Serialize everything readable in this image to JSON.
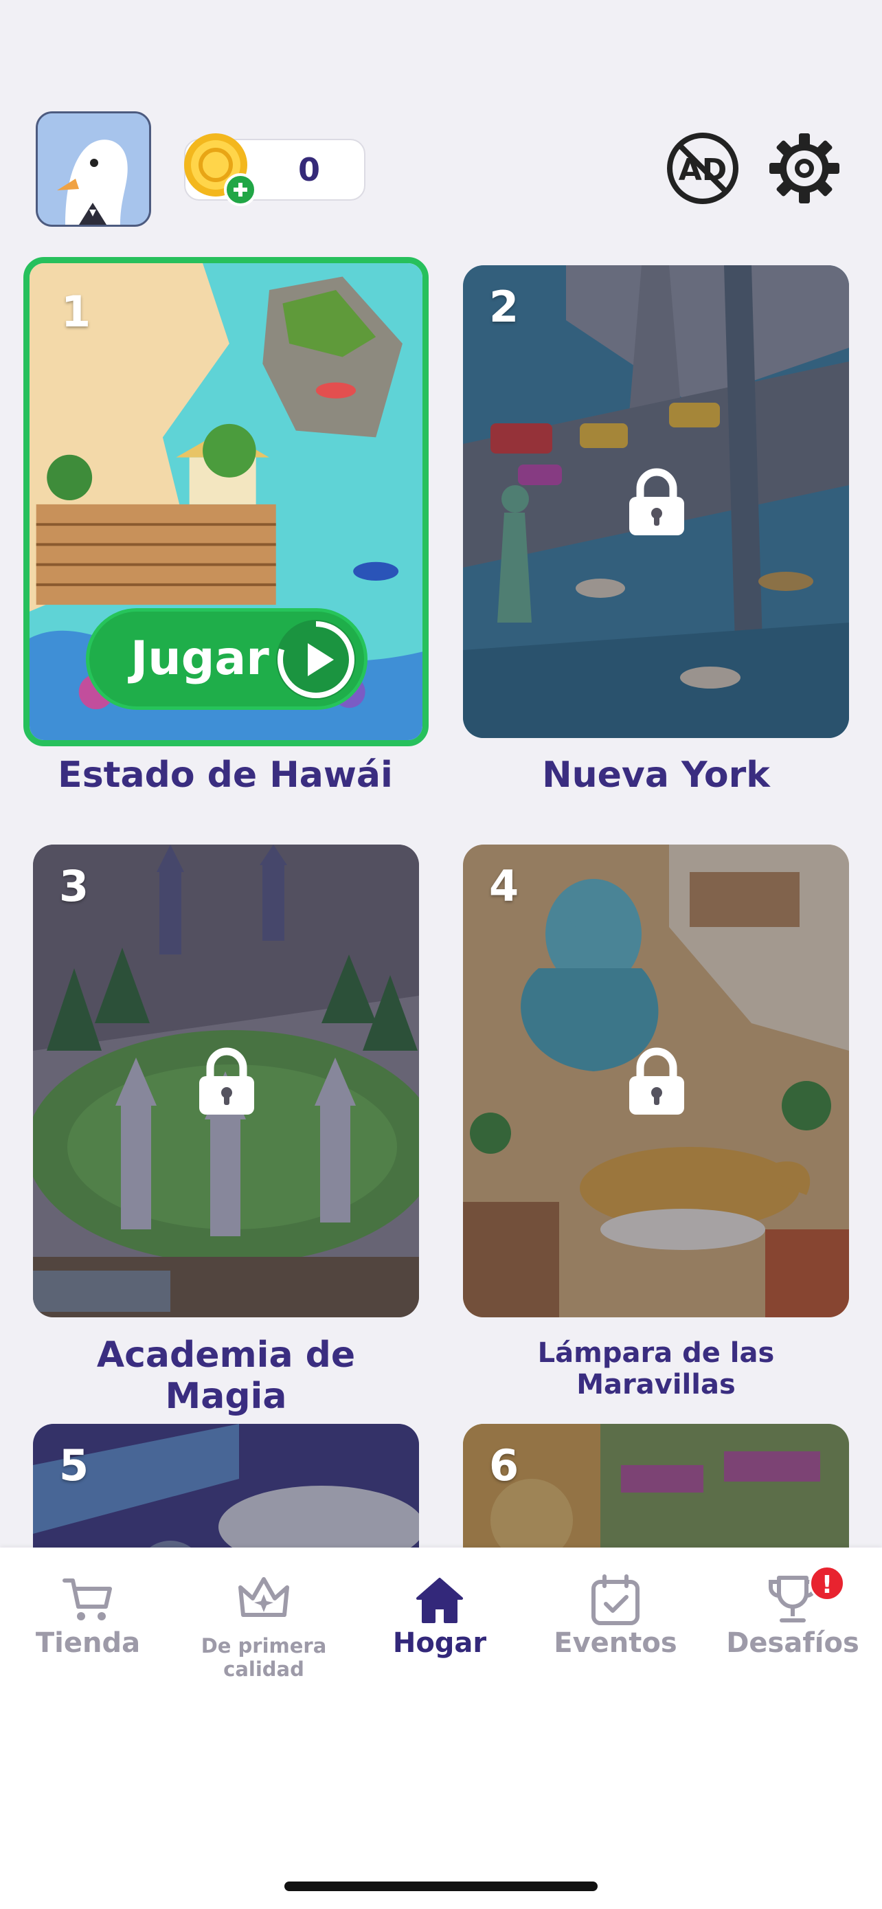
{
  "header": {
    "coins": "0",
    "icons": [
      "avatar-goose",
      "coin-plus-icon",
      "no-ads-icon",
      "gear-icon"
    ]
  },
  "levels": [
    {
      "number": "1",
      "name": "Estado de Hawái",
      "locked": false,
      "play_label": "Jugar"
    },
    {
      "number": "2",
      "name": "Nueva York",
      "locked": true
    },
    {
      "number": "3",
      "name": "Academia de Magia",
      "locked": true
    },
    {
      "number": "4",
      "name": "Lámpara de las Maravillas",
      "locked": true
    },
    {
      "number": "5",
      "locked": true
    },
    {
      "number": "6",
      "locked": true
    }
  ],
  "tabs": [
    {
      "label": "Tienda",
      "icon": "cart-icon",
      "active": false
    },
    {
      "label": "De primera calidad",
      "icon": "crown-icon",
      "active": false
    },
    {
      "label": "Hogar",
      "icon": "home-icon",
      "active": true
    },
    {
      "label": "Eventos",
      "icon": "calendar-icon",
      "active": false
    },
    {
      "label": "Desafíos",
      "icon": "trophy-icon",
      "active": false,
      "badge": "!"
    }
  ],
  "colors": {
    "accent": "#33287a",
    "play_green": "#1fae4a",
    "card_border_active": "#27c05c",
    "badge_red": "#e8232f",
    "background": "#f1f0f5"
  }
}
